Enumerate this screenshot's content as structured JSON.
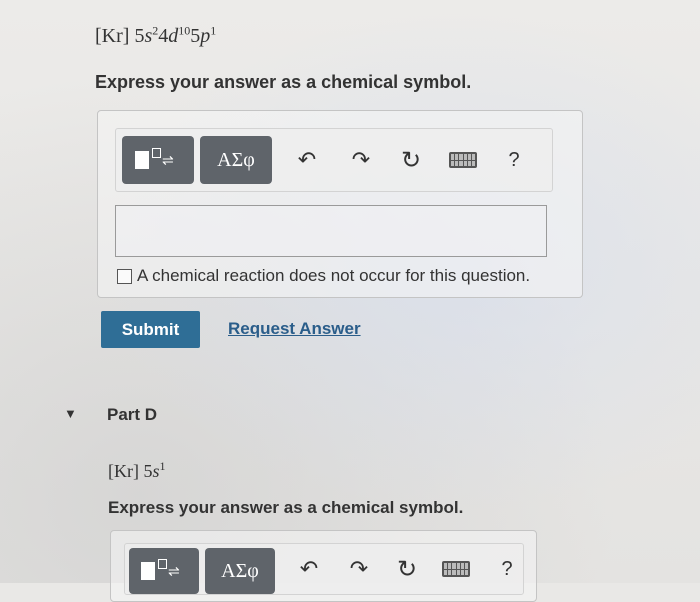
{
  "part_c": {
    "config_core": "[Kr]",
    "config_parts": [
      {
        "coef": "5",
        "orbital": "s",
        "exp": "2"
      },
      {
        "coef": "4",
        "orbital": "d",
        "exp": "10"
      },
      {
        "coef": "5",
        "orbital": "p",
        "exp": "1"
      }
    ],
    "instruction": "Express your answer as a chemical symbol.",
    "toolbar": {
      "greek_label": "ΑΣφ",
      "undo_glyph": "↶",
      "redo_glyph": "↷",
      "reset_glyph": "↻",
      "help_label": "?"
    },
    "answer_value": "",
    "no_reaction_label": "A chemical reaction does not occur for this question.",
    "submit_label": "Submit",
    "request_label": "Request Answer"
  },
  "part_d": {
    "caret": "▼",
    "title": "Part D",
    "config_core": "[Kr]",
    "config_parts": [
      {
        "coef": "5",
        "orbital": "s",
        "exp": "1"
      }
    ],
    "instruction": "Express your answer as a chemical symbol.",
    "toolbar": {
      "greek_label": "ΑΣφ",
      "undo_glyph": "↶",
      "redo_glyph": "↷",
      "reset_glyph": "↻",
      "help_label": "?"
    }
  },
  "icons": [
    "template-icon",
    "greek-icon",
    "undo-icon",
    "redo-icon",
    "reset-icon",
    "keyboard-icon",
    "help-icon",
    "caret-down-icon"
  ],
  "colors": {
    "submit": "#2f6e96",
    "link": "#2a5d8a",
    "toolbar_dark": "#5f646a"
  }
}
